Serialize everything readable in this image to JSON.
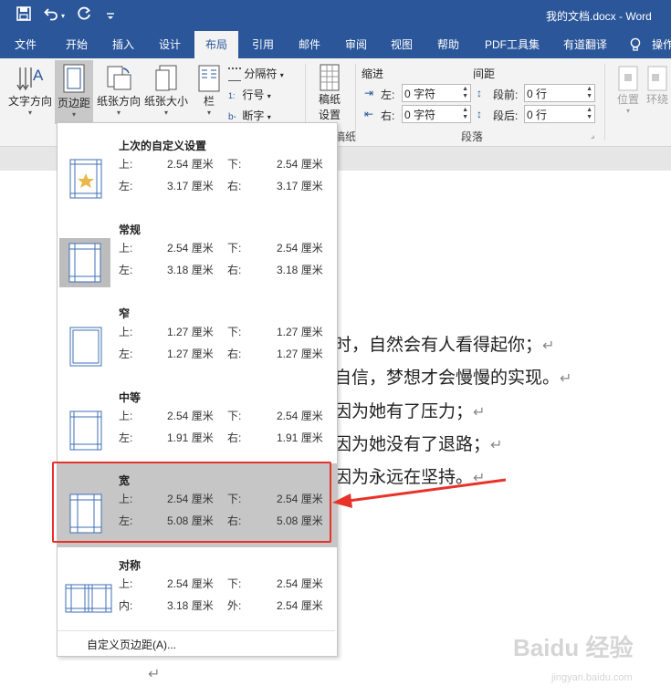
{
  "window": {
    "title": "我的文档.docx  -  Word"
  },
  "qat": {
    "save_glyph": "💾",
    "undo_glyph": "↶",
    "redo_glyph": "↻",
    "more_glyph": "≡"
  },
  "tabs": [
    {
      "label": "文件"
    },
    {
      "label": "开始"
    },
    {
      "label": "插入"
    },
    {
      "label": "设计"
    },
    {
      "label": "布局",
      "active": true
    },
    {
      "label": "引用"
    },
    {
      "label": "邮件"
    },
    {
      "label": "审阅"
    },
    {
      "label": "视图"
    },
    {
      "label": "帮助"
    },
    {
      "label": "PDF工具集"
    },
    {
      "label": "有道翻译"
    },
    {
      "label": "操作"
    }
  ],
  "ribbon": {
    "text_direction": "文字方向",
    "margins": "页边距",
    "orientation": "纸张方向",
    "size": "纸张大小",
    "columns": "栏",
    "breaks": "分隔符",
    "line_numbers": "行号",
    "hyphenation": "断字",
    "draft_paper_1": "稿纸",
    "draft_paper_2": "设置",
    "draft_group": "稿纸",
    "indent_header": "缩进",
    "spacing_header": "间距",
    "indent_left_label": "左:",
    "indent_left_value": "0 字符",
    "indent_right_label": "右:",
    "indent_right_value": "0 字符",
    "space_before_label": "段前:",
    "space_before_value": "0 行",
    "space_after_label": "段后:",
    "space_after_value": "0 行",
    "paragraph_group": "段落",
    "position": "位置",
    "wrap": "环绕"
  },
  "document": {
    "lines": [
      "时，自然会有人看得起你；",
      "自信，梦想才会慢慢的实现。",
      "因为她有了压力；",
      "因为她没有了退路；",
      "因为永远在坚持。"
    ],
    "para_mark": "↵"
  },
  "margins_menu": {
    "presets": [
      {
        "name": "上次的自定义设置",
        "l1": "上:",
        "v1": "2.54 厘米",
        "l2": "下:",
        "v2": "2.54 厘米",
        "l3": "左:",
        "v3": "3.17 厘米",
        "l4": "右:",
        "v4": "3.17 厘米",
        "icon": "star"
      },
      {
        "name": "常规",
        "l1": "上:",
        "v1": "2.54 厘米",
        "l2": "下:",
        "v2": "2.54 厘米",
        "l3": "左:",
        "v3": "3.18 厘米",
        "l4": "右:",
        "v4": "3.18 厘米",
        "icon": "normal"
      },
      {
        "name": "窄",
        "l1": "上:",
        "v1": "1.27 厘米",
        "l2": "下:",
        "v2": "1.27 厘米",
        "l3": "左:",
        "v3": "1.27 厘米",
        "l4": "右:",
        "v4": "1.27 厘米",
        "icon": "narrow"
      },
      {
        "name": "中等",
        "l1": "上:",
        "v1": "2.54 厘米",
        "l2": "下:",
        "v2": "2.54 厘米",
        "l3": "左:",
        "v3": "1.91 厘米",
        "l4": "右:",
        "v4": "1.91 厘米",
        "icon": "moderate"
      },
      {
        "name": "宽",
        "l1": "上:",
        "v1": "2.54 厘米",
        "l2": "下:",
        "v2": "2.54 厘米",
        "l3": "左:",
        "v3": "5.08 厘米",
        "l4": "右:",
        "v4": "5.08 厘米",
        "icon": "wide",
        "selected": true
      },
      {
        "name": "对称",
        "l1": "上:",
        "v1": "2.54 厘米",
        "l2": "下:",
        "v2": "2.54 厘米",
        "l3": "内:",
        "v3": "3.18 厘米",
        "l4": "外:",
        "v4": "2.54 厘米",
        "icon": "mirrored"
      }
    ],
    "custom_label": "自定义页边距(A)..."
  },
  "annotation": {
    "arrow_color": "#e8322a"
  },
  "watermark": {
    "logo": "Baidu 经验",
    "url": "jingyan.baidu.com"
  },
  "colors": {
    "word_blue": "#2b579a",
    "selected": "#c6c6c6",
    "accent_red": "#e8322a"
  }
}
